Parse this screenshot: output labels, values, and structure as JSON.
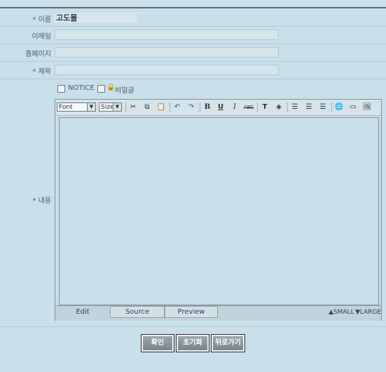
{
  "form": {
    "name_label": "* 이름",
    "name_value": "고도몰",
    "email_label": "이메일",
    "homepage_label": "홈페이지",
    "subject_label": "* 제목",
    "content_label": "* 내용",
    "notice_label": "NOTICE",
    "secret_label": "비밀글"
  },
  "editor": {
    "font_select": "Font",
    "size_select": "Size",
    "tabs": [
      "Edit",
      "Source",
      "Preview"
    ],
    "small_label": "▲SMALL",
    "large_label": "▼LARGE"
  },
  "buttons": {
    "confirm": "확인",
    "reset": "초기화",
    "back": "뒤로가기"
  }
}
